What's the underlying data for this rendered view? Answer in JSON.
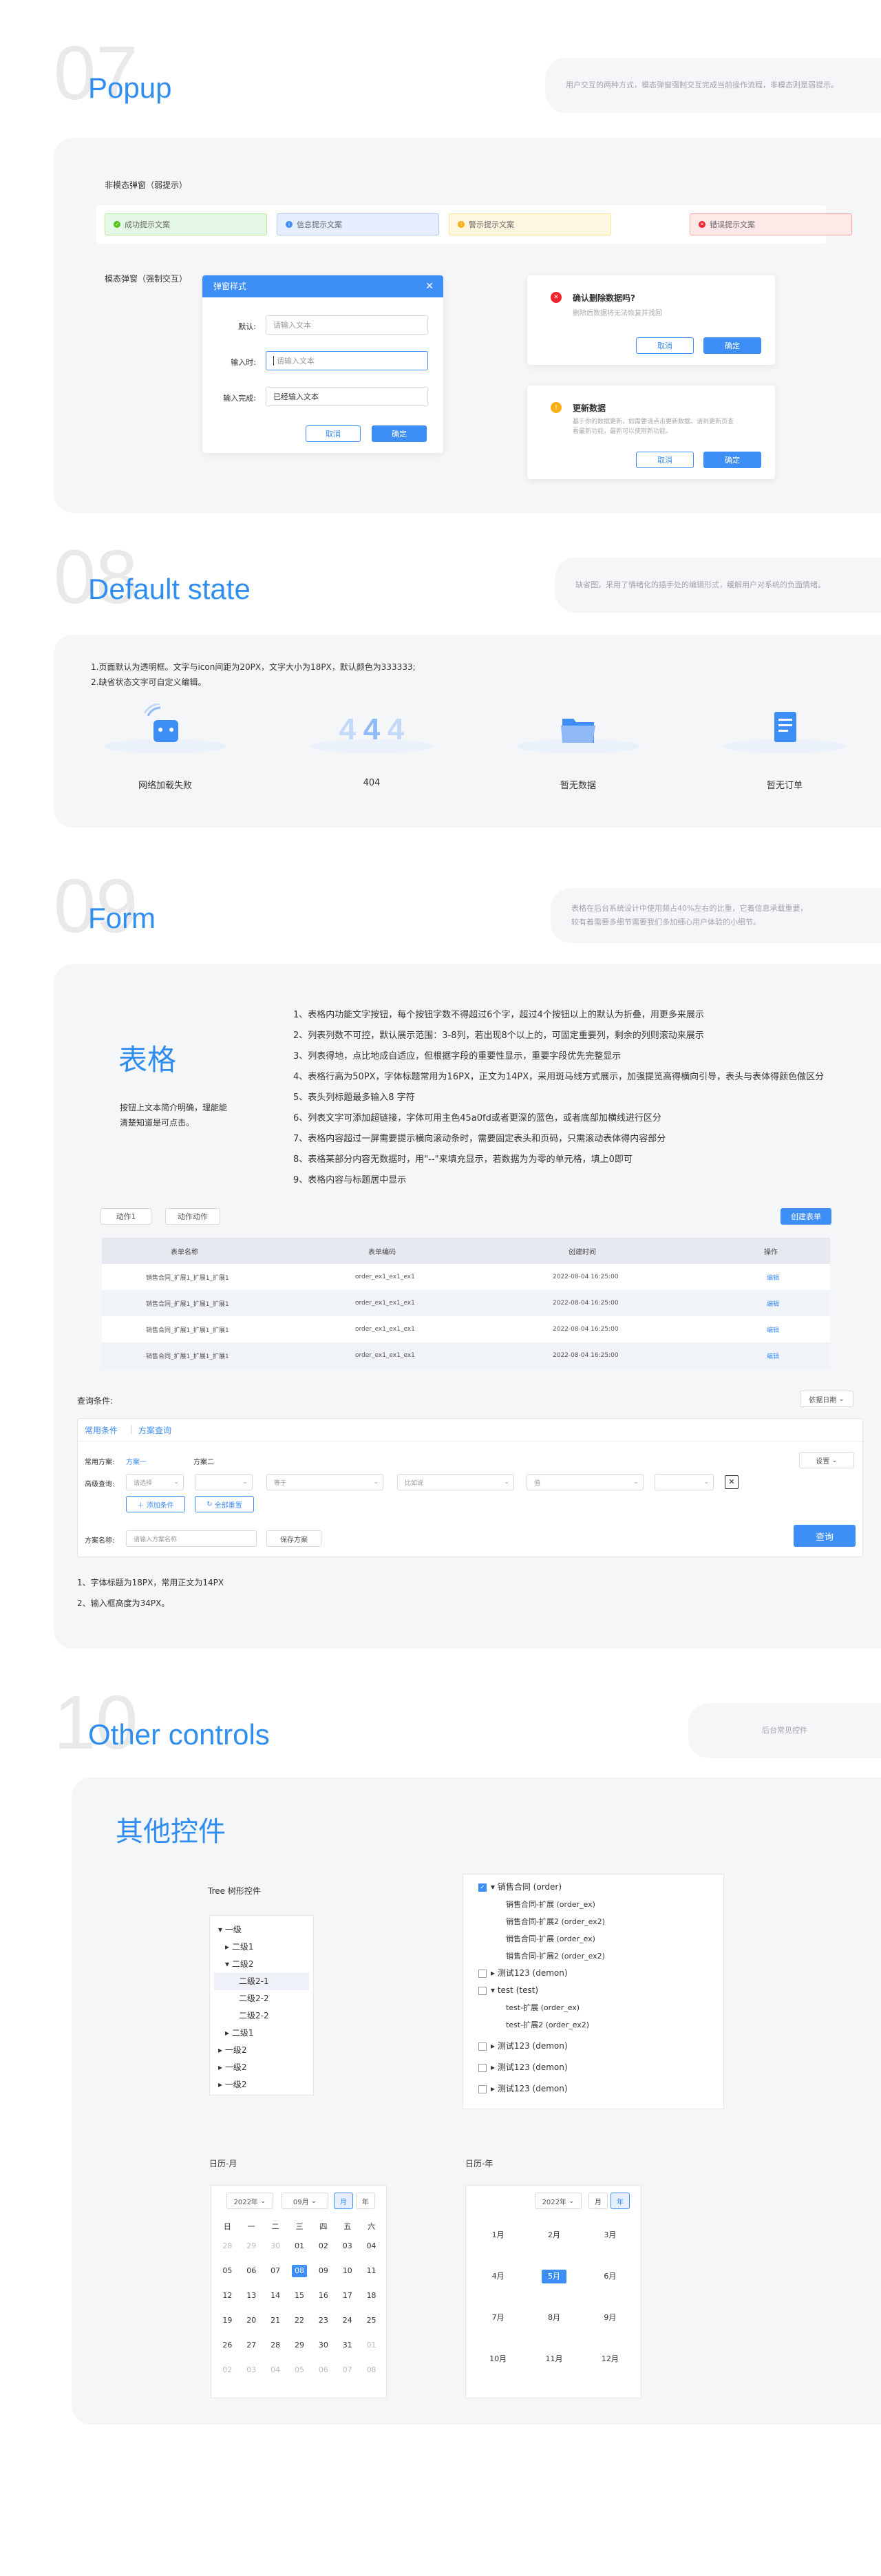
{
  "popup": {
    "num": "07",
    "title": "Popup",
    "desc": "用户交互的两种方式，模态弹窗强制交互完成当前操作流程，非模态则是弱提示。",
    "nonmodal_label": "非模态弹窗（弱提示）",
    "messages": [
      {
        "text": "成功提示文案",
        "color": "#52c41a"
      },
      {
        "text": "信息提示文案",
        "color": "#3e8ef7"
      },
      {
        "text": "警示提示文案",
        "color": "#faad14"
      },
      {
        "text": "错误提示文案",
        "color": "#f5222d"
      }
    ],
    "modal_label": "模态弹窗（强制交互）",
    "dialog": {
      "title": "弹窗样式",
      "fields": [
        {
          "label": "默认:",
          "value": "请输入文本"
        },
        {
          "label": "输入时:",
          "value": "请输入文本"
        },
        {
          "label": "输入完成:",
          "value": "已经输入文本"
        }
      ],
      "cancel": "取消",
      "confirm": "确定"
    },
    "confirm_delete": {
      "title": "确认删除数据吗?",
      "desc": "删除后数据将无法恢复并找回",
      "cancel": "取消",
      "confirm": "确定"
    },
    "update": {
      "title": "更新数据",
      "desc": "基于你的数据更新，如需要请点击更新数据。请到更新页查看最新功能，最新可以使用新功能。",
      "cancel": "取消",
      "confirm": "确定"
    }
  },
  "default_state": {
    "num": "08",
    "title": "Default state",
    "desc": "缺省图，采用了情绪化的插手处的编辑形式，缓解用户对系统的负面情绪。",
    "rule1": "1.页面默认为透明框。文字与icon间距为20PX，文字大小为18PX，默认颜色为333333;",
    "rule2": "2.缺省状态文字可自定义编辑。",
    "items": [
      {
        "label": "网络加载失败",
        "icon": "network-error-icon"
      },
      {
        "label": "404",
        "icon": "404-icon"
      },
      {
        "label": "暂无数据",
        "icon": "folder-icon"
      },
      {
        "label": "暂无订单",
        "icon": "order-icon"
      }
    ]
  },
  "form": {
    "num": "09",
    "title": "Form",
    "desc1": "表格在后台系统设计中使用频占40%左右的比重，它着信息承载重要，",
    "desc2": "较有着需要多细节需要我们多加细心用户体验的小细节。",
    "heading": "表格",
    "intro": "按钮上文本简介明确，理能能清楚知道是可点击。",
    "rules": [
      "1、表格内功能文字按钮，每个按钮字数不得超过6个字，超过4个按钮以上的默认为折叠，用更多来展示",
      "2、列表列数不可控，默认展示范围：3-8列，若出现8个以上的，可固定重要列，剩余的列则滚动来展示",
      "3、列表得地，点比地成自适应，但根据字段的重要性显示，重要字段优先完整显示",
      "4、表格行高为50PX，字体标题常用为16PX，正文为14PX，采用斑马线方式展示，加强提览高得横向引导，表头与表体得颜色做区分",
      "5、表头列标题最多输入8 字符",
      "6、列表文字可添加超链接，字体可用主色45a0fd或者更深的蓝色，或者底部加横线进行区分",
      "7、表格内容超过一屏需要提示横向滚动条时，需要固定表头和页码，只需滚动表体得内容部分",
      "8、表格某部分内容无数据时，用\"--\"来填充显示，若数据为为零的单元格，填上0即可",
      "9、表格内容与标题居中显示"
    ],
    "btn_a": "动作1",
    "btn_b": "动作动作",
    "btn_create": "创建表单",
    "columns": [
      "表单名称",
      "表单编码",
      "创建时间",
      "操作"
    ],
    "rows": [
      [
        "销售合同_扩展1_扩展1_扩展1",
        "order_ex1_ex1_ex1",
        "2022-08-04 16:25:00",
        "编辑"
      ],
      [
        "销售合同_扩展1_扩展1_扩展1",
        "order_ex1_ex1_ex1",
        "2022-08-04 16:25:00",
        "编辑"
      ],
      [
        "销售合同_扩展1_扩展1_扩展1",
        "order_ex1_ex1_ex1",
        "2022-08-04 16:25:00",
        "编辑"
      ],
      [
        "销售合同_扩展1_扩展1_扩展1",
        "order_ex1_ex1_ex1",
        "2022-08-04 16:25:00",
        "编辑"
      ]
    ],
    "query_label": "查询条件:",
    "query_sel": "依据日期",
    "tabs": [
      "常用条件",
      "方案查询"
    ],
    "plan_label": "常用方案:",
    "plan1": "方案一",
    "plan2": "方案二",
    "settings": "设置",
    "adv_label": "高级查询:",
    "conds": [
      "请选择",
      "",
      "等于",
      "比如说",
      "值",
      ""
    ],
    "add_cond": "添加条件",
    "reset": "全部重置",
    "scheme_label": "方案名称:",
    "scheme_ph": "请输入方案名称",
    "save": "保存方案",
    "search": "查询",
    "notes": [
      "1、字体标题为18PX，常用正文为14PX",
      "2、输入框高度为34PX。"
    ]
  },
  "other": {
    "num": "10",
    "title": "Other controls",
    "desc": "后台常见控件",
    "heading": "其他控件",
    "tree_label": "Tree 树形控件",
    "tree": [
      {
        "t": "▾ 一级",
        "d": 0
      },
      {
        "t": "▸ 二级1",
        "d": 1
      },
      {
        "t": "▾ 二级2",
        "d": 1
      },
      {
        "t": "二级2-1",
        "d": 2,
        "sel": true
      },
      {
        "t": "二级2-2",
        "d": 2
      },
      {
        "t": "二级2-2",
        "d": 2
      },
      {
        "t": "▸ 二级1",
        "d": 1
      },
      {
        "t": "▸ 一级2",
        "d": 0
      },
      {
        "t": "▸ 一级2",
        "d": 0
      },
      {
        "t": "▸ 一级2",
        "d": 0
      }
    ],
    "checktree": [
      {
        "t": "▾ 销售合同 (order)",
        "c": true,
        "d": 0
      },
      {
        "t": "销售合同-扩展 (order_ex)",
        "d": 2
      },
      {
        "t": "销售合同-扩展2 (order_ex2)",
        "d": 2
      },
      {
        "t": "销售合同-扩展 (order_ex)",
        "d": 2
      },
      {
        "t": "销售合同-扩展2 (order_ex2)",
        "d": 2
      },
      {
        "t": "▸ 测试123 (demon)",
        "c": false,
        "d": 0
      },
      {
        "t": "▾ test (test)",
        "c": false,
        "d": 0
      },
      {
        "t": "test-扩展 (order_ex)",
        "d": 2
      },
      {
        "t": "test-扩展2 (order_ex2)",
        "d": 2
      },
      {
        "t": "▸ 测试123 (demon)",
        "c": false,
        "d": 0
      },
      {
        "t": "▸ 测试123 (demon)",
        "c": false,
        "d": 0
      },
      {
        "t": "▸ 测试123 (demon)",
        "c": false,
        "d": 0
      }
    ],
    "cal_month_label": "日历-月",
    "cal_year_label": "日历-年",
    "cal": {
      "year": "2022年",
      "month": "09月",
      "m": "月",
      "y": "年",
      "weekdays": [
        "日",
        "一",
        "二",
        "三",
        "四",
        "五",
        "六"
      ],
      "days": [
        [
          "28",
          "m"
        ],
        [
          "29",
          "m"
        ],
        [
          "30",
          "m"
        ],
        [
          "01",
          ""
        ],
        [
          "02",
          ""
        ],
        [
          "03",
          ""
        ],
        [
          "04",
          ""
        ],
        [
          "05",
          ""
        ],
        [
          "06",
          ""
        ],
        [
          "07",
          ""
        ],
        [
          "08",
          "s"
        ],
        [
          "09",
          ""
        ],
        [
          "10",
          ""
        ],
        [
          "11",
          ""
        ],
        [
          "12",
          ""
        ],
        [
          "13",
          ""
        ],
        [
          "14",
          ""
        ],
        [
          "15",
          ""
        ],
        [
          "16",
          ""
        ],
        [
          "17",
          ""
        ],
        [
          "18",
          ""
        ],
        [
          "19",
          ""
        ],
        [
          "20",
          ""
        ],
        [
          "21",
          ""
        ],
        [
          "22",
          ""
        ],
        [
          "23",
          ""
        ],
        [
          "24",
          ""
        ],
        [
          "25",
          ""
        ],
        [
          "26",
          ""
        ],
        [
          "27",
          ""
        ],
        [
          "28",
          ""
        ],
        [
          "29",
          ""
        ],
        [
          "30",
          ""
        ],
        [
          "31",
          ""
        ],
        [
          "01",
          "m"
        ],
        [
          "02",
          "m"
        ],
        [
          "03",
          "m"
        ],
        [
          "04",
          "m"
        ],
        [
          "05",
          "m"
        ],
        [
          "06",
          "m"
        ],
        [
          "07",
          "m"
        ],
        [
          "08",
          "m"
        ]
      ]
    },
    "months": [
      "1月",
      "2月",
      "3月",
      "4月",
      "5月",
      "6月",
      "7月",
      "8月",
      "9月",
      "10月",
      "11月",
      "12月"
    ]
  }
}
